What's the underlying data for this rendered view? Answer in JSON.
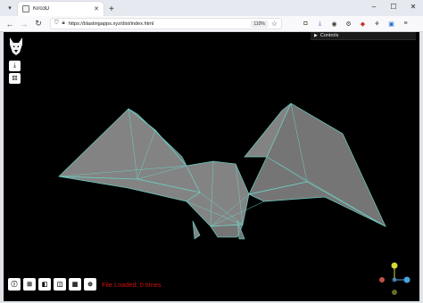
{
  "browser": {
    "tab_title": "Kiro3D",
    "new_tab_symbol": "+",
    "url": "https://blastingapps.xyz/dist/index.html",
    "zoom_level": "110%",
    "window_controls": {
      "minimize": "–",
      "maximize": "☐",
      "close": "✕"
    }
  },
  "app": {
    "controls_panel_label": "Controls",
    "status_text": "File Loaded: 0 times",
    "status_color": "#d01010",
    "mesh_fill": "#8a8a8a",
    "wire_color": "#6fd0c4",
    "background": "#000000",
    "left_tools": [
      {
        "name": "open-file-icon",
        "glyph": "⤓"
      },
      {
        "name": "dice-icon",
        "glyph": "⚄"
      }
    ],
    "bottom_tools": [
      {
        "name": "info-icon",
        "glyph": "ⓘ"
      },
      {
        "name": "wireframe-toggle-icon",
        "glyph": "⊞"
      },
      {
        "name": "camera-icon",
        "glyph": "◧"
      },
      {
        "name": "split-view-icon",
        "glyph": "◫"
      },
      {
        "name": "grid-icon",
        "glyph": "▦"
      },
      {
        "name": "globe-icon",
        "glyph": "⊕"
      }
    ],
    "axis_gizmo_colors": {
      "y": "#d8d83a",
      "x": "#c0504d",
      "z": "#4aa3df",
      "neg": "#6b6b2a"
    }
  }
}
